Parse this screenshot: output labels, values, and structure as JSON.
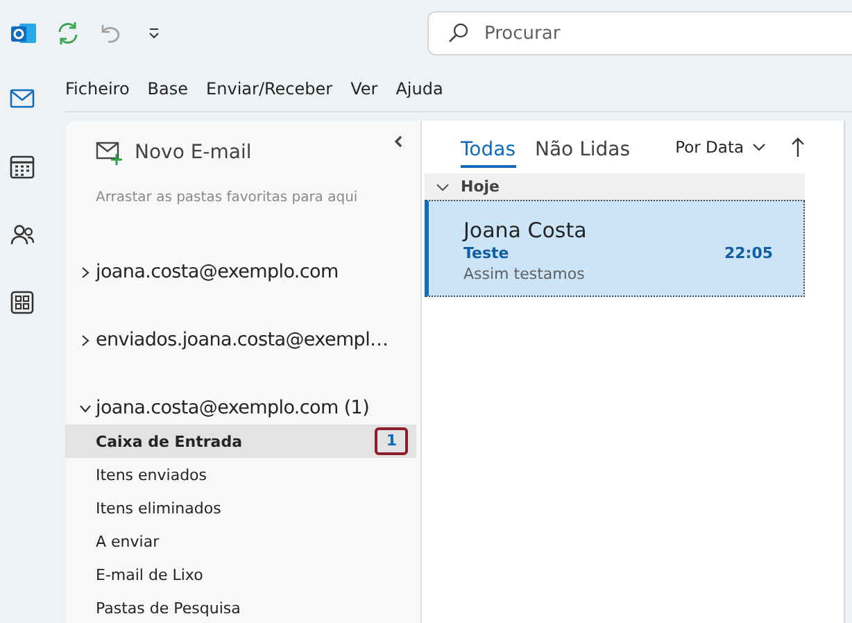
{
  "toolbar": {
    "search": {
      "placeholder": "Procurar"
    }
  },
  "menu": [
    "Ficheiro",
    "Base",
    "Enviar/Receber",
    "Ver",
    "Ajuda"
  ],
  "rail": [
    {
      "kind": "mail",
      "selected": true
    },
    {
      "kind": "calendar",
      "selected": false
    },
    {
      "kind": "people",
      "selected": false
    },
    {
      "kind": "apps",
      "selected": false
    }
  ],
  "folder_pane": {
    "new_button": "Novo E-mail",
    "favorites_hint": "Arrastar as pastas favoritas para aqui",
    "accounts": [
      {
        "name": "joana.costa@exemplo.com",
        "expanded": false
      },
      {
        "name": "enviados.joana.costa@exempl…",
        "expanded": false
      },
      {
        "name": "joana.costa@exemplo.com (1)",
        "expanded": true,
        "children": [
          {
            "label": "Caixa de Entrada",
            "selected": true,
            "badge": "1"
          },
          {
            "label": "Itens enviados",
            "selected": false
          },
          {
            "label": "Itens eliminados",
            "selected": false
          },
          {
            "label": "A enviar",
            "selected": false
          },
          {
            "label": "E-mail de Lixo",
            "selected": false
          },
          {
            "label": "Pastas de Pesquisa",
            "selected": false
          }
        ]
      }
    ]
  },
  "message_list": {
    "tabs": [
      {
        "label": "Todas",
        "selected": true
      },
      {
        "label": "Não Lidas",
        "selected": false
      }
    ],
    "sort": "Por Data",
    "groups": [
      {
        "label": "Hoje",
        "expanded": true,
        "messages": [
          {
            "sender": "Joana Costa",
            "subject": "Teste",
            "time": "22:05",
            "preview": "Assim testamos",
            "selected": true,
            "unread": true
          }
        ]
      }
    ]
  }
}
